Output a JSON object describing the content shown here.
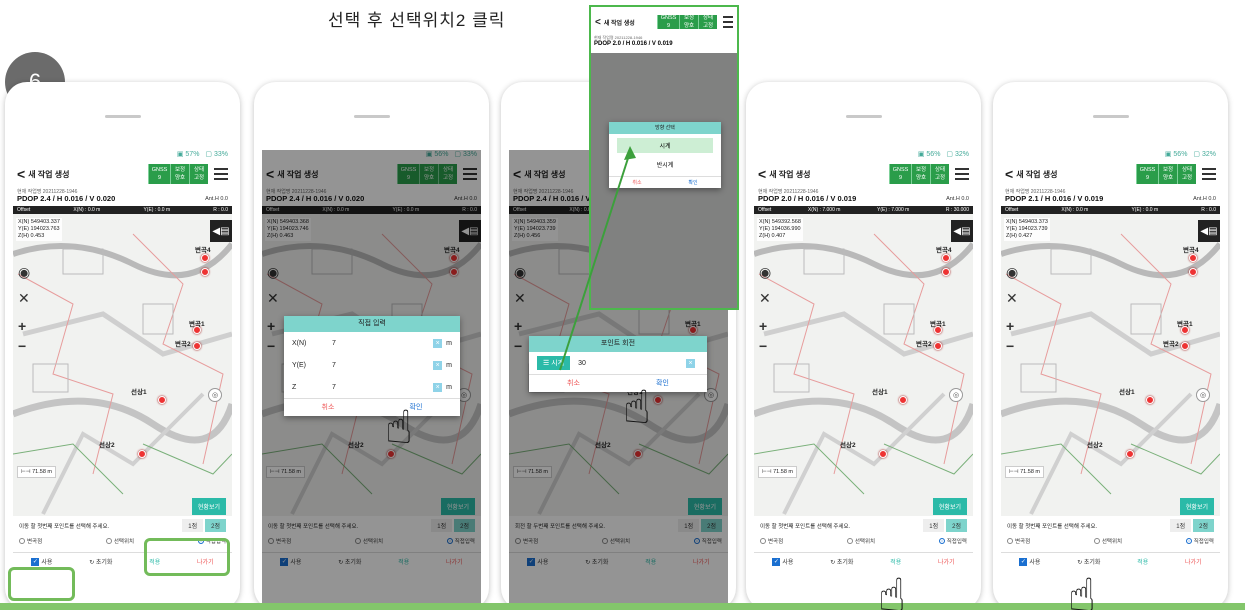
{
  "caption": "선택 후 선택위치2 클릭",
  "step": "6",
  "app": {
    "title": "새 작업 생성",
    "back_icon": "<",
    "gnss_cells": [
      {
        "label": "GNSS",
        "value": "9"
      },
      {
        "label": "보정",
        "value": "양호"
      },
      {
        "label": "상태",
        "value": "고정"
      }
    ],
    "work_label": "현재 작업명 20211228-1946",
    "anth": "Ant.H  0.0",
    "offset": {
      "label": "Offset",
      "xn": "X(N) : 0.0 m",
      "ye": "Y(E) : 0.0 m",
      "r": "R : 0.0"
    },
    "scale": "71.58 m",
    "view_button": "현황보기",
    "instruction": "이동 할 첫번째 포인트를 선택해 주세요.",
    "rotate_instruction": "회전 할 두번째 포인트를 선택해 주세요.",
    "points": [
      "1점",
      "2점"
    ],
    "radios": [
      "변곡점",
      "선택위치",
      "직접입력"
    ],
    "actions": {
      "use": "사용",
      "reset": "초기화",
      "apply": "적용",
      "exit": "나가기"
    },
    "pins": [
      "변곡4",
      "변곡1",
      "변곡2",
      "선상1",
      "선상2"
    ]
  },
  "phones": [
    {
      "battery": "57%",
      "battery2": "33%",
      "pdop": "PDOP 2.4 / H 0.016 / V 0.020",
      "coords": [
        "X(N) 549403.337",
        "Y(E) 194023.763",
        "Z(H) 0.453"
      ]
    },
    {
      "battery": "56%",
      "battery2": "33%",
      "pdop": "PDOP 2.4 / H 0.016 / V 0.020",
      "coords": [
        "X(N) 549403.368",
        "Y(E) 194023.746",
        "Z(H) 0.463"
      ]
    },
    {
      "battery": "56%",
      "battery2": "33%",
      "pdop": "PDOP 2.4 / H 0.016 / V 0.0",
      "coords": [
        "X(N) 549403.359",
        "Y(E) 194023.739",
        "Z(H) 0.456"
      ]
    },
    {
      "battery": "56%",
      "battery2": "32%",
      "pdop": "PDOP 2.0 / H 0.016 / V 0.019",
      "coords": [
        "X(N) 549392.568",
        "Y(E) 194036.990",
        "Z(H) 0.407"
      ],
      "offset": {
        "xn": "X(N) : 7.000 m",
        "ye": "Y(E) : 7.000 m",
        "r": "R : 30.000"
      }
    },
    {
      "battery": "56%",
      "battery2": "32%",
      "pdop": "PDOP 2.1 / H 0.016 / V 0.019",
      "coords": [
        "X(N) 549403.373",
        "Y(E) 194023.739",
        "Z(H) 0.427"
      ]
    }
  ],
  "direct_input": {
    "title": "직접 입력",
    "rows": [
      {
        "label": "X(N)",
        "value": "7",
        "unit": "m"
      },
      {
        "label": "Y(E)",
        "value": "7",
        "unit": "m"
      },
      {
        "label": "Z",
        "value": "7",
        "unit": "m"
      }
    ],
    "cancel": "취소",
    "ok": "확인"
  },
  "rotate_dialog": {
    "title": "포인트 회전",
    "direction": "시계",
    "value": "30",
    "cancel": "취소",
    "ok": "확인"
  },
  "direction_dialog": {
    "title": "방향 선택",
    "options": [
      "시계",
      "반시계"
    ],
    "cancel": "취소",
    "ok": "확인"
  },
  "inset": {
    "pdop": "PDOP 2.0 / H 0.016 / V 0.019",
    "work_label": "현재 작업명 20211228-1946"
  },
  "colors": {
    "accent": "#2bbaa8",
    "highlight": "#73bb5a",
    "pin": "#e33333",
    "gnss": "#2a9d4a"
  }
}
